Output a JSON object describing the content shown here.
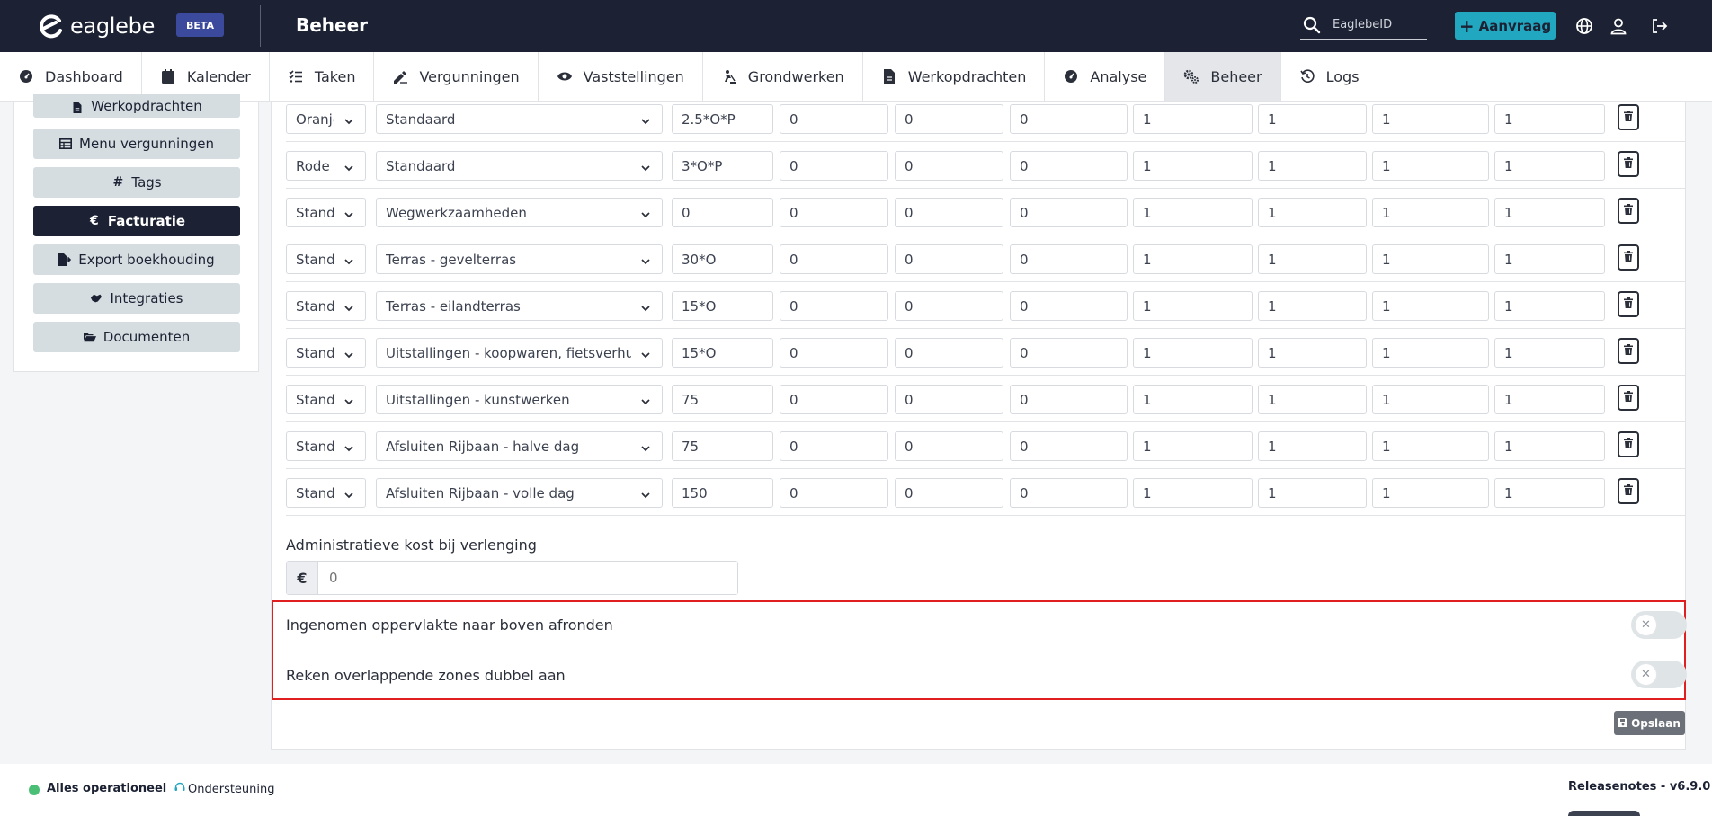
{
  "header": {
    "logo_text": "eaglebe",
    "beta_label": "BETA",
    "title": "Beheer",
    "search_placeholder": "EaglebeID",
    "aanvraag_label": "Aanvraag"
  },
  "nav": {
    "items": [
      {
        "label": "Dashboard",
        "icon": "gauge-icon"
      },
      {
        "label": "Kalender",
        "icon": "calendar-icon"
      },
      {
        "label": "Taken",
        "icon": "tasks-icon"
      },
      {
        "label": "Vergunningen",
        "icon": "signature-icon"
      },
      {
        "label": "Vaststellingen",
        "icon": "eye-icon"
      },
      {
        "label": "Grondwerken",
        "icon": "digging-icon"
      },
      {
        "label": "Werkopdrachten",
        "icon": "file-icon"
      },
      {
        "label": "Analyse",
        "icon": "gauge-icon"
      },
      {
        "label": "Beheer",
        "icon": "cogs-icon",
        "active": true
      },
      {
        "label": "Logs",
        "icon": "history-icon"
      }
    ]
  },
  "sidebar": {
    "items": [
      {
        "label": "Werkopdrachten",
        "icon": "file-icon"
      },
      {
        "label": "Menu vergunningen",
        "icon": "table-icon"
      },
      {
        "label": "Tags",
        "icon": "hash-icon"
      },
      {
        "label": "Facturatie",
        "icon": "euro-icon",
        "active": true
      },
      {
        "label": "Export boekhouding",
        "icon": "file-export-icon"
      },
      {
        "label": "Integraties",
        "icon": "handshake-icon"
      },
      {
        "label": "Documenten",
        "icon": "folder-open-icon"
      }
    ]
  },
  "pricing": {
    "rows": [
      {
        "zone": "Oranje",
        "type": "Standaard",
        "formula": "2.5*O*P",
        "v1": "0",
        "v2": "0",
        "v3": "0",
        "v4": "1",
        "v5": "1",
        "v6": "1",
        "v7": "1"
      },
      {
        "zone": "Rode",
        "type": "Standaard",
        "formula": "3*O*P",
        "v1": "0",
        "v2": "0",
        "v3": "0",
        "v4": "1",
        "v5": "1",
        "v6": "1",
        "v7": "1"
      },
      {
        "zone": "Standaard",
        "type": "Wegwerkzaamheden",
        "formula": "0",
        "v1": "0",
        "v2": "0",
        "v3": "0",
        "v4": "1",
        "v5": "1",
        "v6": "1",
        "v7": "1"
      },
      {
        "zone": "Standaard",
        "type": "Terras - gevelterras",
        "formula": "30*O",
        "v1": "0",
        "v2": "0",
        "v3": "0",
        "v4": "1",
        "v5": "1",
        "v6": "1",
        "v7": "1"
      },
      {
        "zone": "Standaard",
        "type": "Terras - eilandterras",
        "formula": "15*O",
        "v1": "0",
        "v2": "0",
        "v3": "0",
        "v4": "1",
        "v5": "1",
        "v6": "1",
        "v7": "1"
      },
      {
        "zone": "Standaard",
        "type": "Uitstallingen - koopwaren, fietsverhuring",
        "formula": "15*O",
        "v1": "0",
        "v2": "0",
        "v3": "0",
        "v4": "1",
        "v5": "1",
        "v6": "1",
        "v7": "1"
      },
      {
        "zone": "Standaard",
        "type": "Uitstallingen - kunstwerken",
        "formula": "75",
        "v1": "0",
        "v2": "0",
        "v3": "0",
        "v4": "1",
        "v5": "1",
        "v6": "1",
        "v7": "1"
      },
      {
        "zone": "Standaard",
        "type": "Afsluiten Rijbaan - halve dag",
        "formula": "75",
        "v1": "0",
        "v2": "0",
        "v3": "0",
        "v4": "1",
        "v5": "1",
        "v6": "1",
        "v7": "1"
      },
      {
        "zone": "Standaard",
        "type": "Afsluiten Rijbaan - volle dag",
        "formula": "150",
        "v1": "0",
        "v2": "0",
        "v3": "0",
        "v4": "1",
        "v5": "1",
        "v6": "1",
        "v7": "1"
      }
    ]
  },
  "admin_cost": {
    "label": "Administratieve kost bij verlenging",
    "currency": "€",
    "placeholder": "0"
  },
  "toggles": [
    {
      "label": "Ingenomen oppervlakte naar boven afronden",
      "on": false
    },
    {
      "label": "Reken overlappende zones dubbel aan",
      "on": false
    }
  ],
  "save_label": "Opslaan",
  "footer": {
    "status": "Alles operationeel",
    "separator": "-",
    "support": "Ondersteuning",
    "release": "Releasenotes - v6.9.0"
  },
  "colors": {
    "header_bg": "#1c2233",
    "accent": "#22a7c0",
    "highlight_border": "#e02020",
    "status_ok": "#4cbf77"
  }
}
